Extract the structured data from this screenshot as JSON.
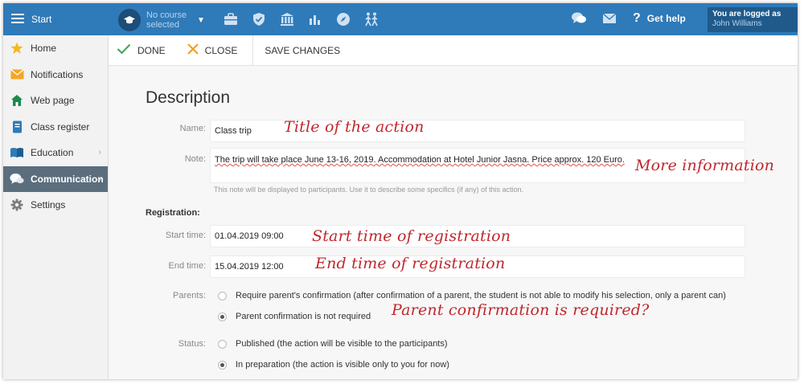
{
  "topbar": {
    "start_label": "Start",
    "course_label": "No course selected",
    "help_label": "Get help",
    "logged_in_label": "You are logged as",
    "user_name": "John Williams",
    "colors": {
      "bar": "#2f7ab9",
      "logged_box": "#1f5a8b",
      "muted_text": "#b9d3ea"
    },
    "icons": [
      "graduation-cap-icon",
      "briefcase-icon",
      "shield-icon",
      "institution-icon",
      "bar-chart-icon",
      "compass-icon",
      "people-walking-icon",
      "chat-bubbles-icon",
      "envelope-icon",
      "question-icon"
    ]
  },
  "sidebar": {
    "items": [
      {
        "label": "Home",
        "icon": "star-icon"
      },
      {
        "label": "Notifications",
        "icon": "envelope-icon"
      },
      {
        "label": "Web page",
        "icon": "house-icon"
      },
      {
        "label": "Class register",
        "icon": "notebook-icon"
      },
      {
        "label": "Education",
        "icon": "book-icon"
      },
      {
        "label": "Communication",
        "icon": "chat-icon",
        "active": true
      },
      {
        "label": "Settings",
        "icon": "gear-icon"
      }
    ],
    "active_color": "#5b6e7e"
  },
  "toolbar": {
    "done_label": "DONE",
    "close_label": "CLOSE",
    "save_label": "SAVE CHANGES"
  },
  "form": {
    "title": "Description",
    "name_label": "Name:",
    "name_value": "Class trip",
    "note_label": "Note:",
    "note_value": "The trip will take place June 13-16, 2019. Accommodation at Hotel Junior Jasna. Price approx. 120 Euro.",
    "note_hint": "This note will be displayed to participants. Use it to describe some specifics (if any) of this action.",
    "registration_heading": "Registration:",
    "start_label": "Start time:",
    "start_value": "01.04.2019 09:00",
    "end_label": "End time:",
    "end_value": "15.04.2019 12:00",
    "parents_label": "Parents:",
    "parents_options": [
      {
        "label": "Require parent's confirmation (after confirmation of a parent, the student is not able to modify his selection, only a parent can)",
        "selected": false
      },
      {
        "label": "Parent confirmation is not required",
        "selected": true
      }
    ],
    "status_label": "Status:",
    "status_options": [
      {
        "label": "Published (the action will be visible to the participants)",
        "selected": false
      },
      {
        "label": "In preparation (the action is visible only to you for now)",
        "selected": true
      }
    ]
  },
  "annotations": {
    "title": "Title of the action",
    "more_info": "More information",
    "start": "Start time of registration",
    "end": "End time of registration",
    "parent": "Parent confirmation is required?",
    "color": "#c0272d"
  }
}
